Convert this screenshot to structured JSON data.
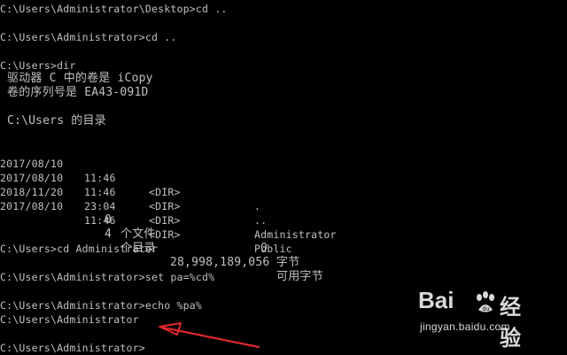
{
  "console": {
    "lines": {
      "l1": "C:\\Users\\Administrator\\Desktop>cd ..",
      "l2": "C:\\Users\\Administrator>cd ..",
      "l3": "C:\\Users>dir",
      "l4": " 驱动器 C 中的卷是 iCopy",
      "l5": " 卷的序列号是 EA43-091D",
      "l6": " C:\\Users 的目录",
      "l7": "C:\\Users>cd Administrator",
      "l8": "C:\\Users\\Administrator>set pa=%cd%",
      "l9": "C:\\Users\\Administrator>echo %pa%",
      "l10": "C:\\Users\\Administrator",
      "l11": "C:\\Users\\Administrator>"
    },
    "dir_rows": [
      {
        "date": "2017/08/10",
        "time": "11:46",
        "type": "<DIR>",
        "name": "."
      },
      {
        "date": "2017/08/10",
        "time": "11:46",
        "type": "<DIR>",
        "name": ".."
      },
      {
        "date": "2018/11/20",
        "time": "23:04",
        "type": "<DIR>",
        "name": "Administrator"
      },
      {
        "date": "2017/08/10",
        "time": "11:46",
        "type": "<DIR>",
        "name": "Public"
      }
    ],
    "summary": {
      "files_count": "0",
      "files_label": "个文件",
      "files_bytes": "0",
      "bytes_label": "字节",
      "dirs_count": "4",
      "dirs_label": "个目录",
      "free_bytes": "28,998,189,056",
      "free_label": "可用字节"
    }
  },
  "watermark": {
    "logo": "Bai",
    "cn": "经验",
    "url": "jingyan.baidu.com"
  },
  "colors": {
    "background": "#000000",
    "text": "#c0c0c0",
    "arrow": "#e0282c"
  }
}
